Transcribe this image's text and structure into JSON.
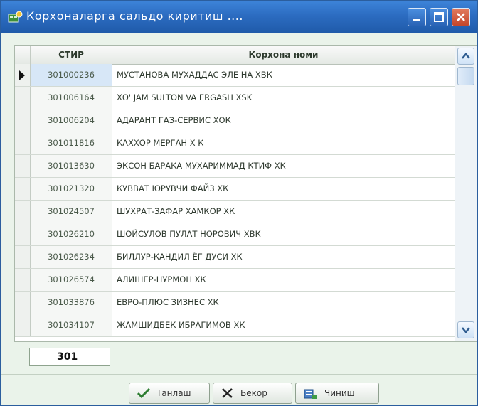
{
  "window": {
    "title": "Корхоналарга сальдо киритиш ...."
  },
  "grid": {
    "columns": [
      "СТИР",
      "Корхона номи"
    ],
    "rows": [
      {
        "code": "301000236",
        "name": "МУСТАНОВА МУХАДДАС ЭЛЕ НА ХВК"
      },
      {
        "code": "301006164",
        "name": "ХО' JAM SULTON VA ERGASH XSK"
      },
      {
        "code": "301006204",
        "name": "АДАРАНТ ГАЗ-СЕРВИС ХОК"
      },
      {
        "code": "301011816",
        "name": "КАХХОР МЕРГАН Х К"
      },
      {
        "code": "301013630",
        "name": "ЭКСОН БАРАКА МУХАРИММАД КТИФ ХК"
      },
      {
        "code": "301021320",
        "name": "КУВВАТ ЮРУВЧИ ФАЙЗ ХК"
      },
      {
        "code": "301024507",
        "name": "ШУХРАТ-ЗАФАР ХАМКОР ХК"
      },
      {
        "code": "301026210",
        "name": "ШОЙСУЛОВ ПУЛАТ НОРОВИЧ ХВК"
      },
      {
        "code": "301026234",
        "name": "БИЛЛУР-КАНДИЛ ЁГ ДУСИ ХК"
      },
      {
        "code": "301026574",
        "name": "АЛИШЕР-НУРМОН ХК"
      },
      {
        "code": "301033876",
        "name": "ЕВРО-ПЛЮС ЗИЗНЕС ХК"
      },
      {
        "code": "301034107",
        "name": "ЖАМШИДБЕК ИБРАГИМОВ ХК"
      }
    ]
  },
  "search": {
    "value": "301"
  },
  "buttons": {
    "ok": "Танлаш",
    "cancel": "Бекор",
    "clear": "Чиниш"
  },
  "colors": {
    "titlebar": "#2c6cc1",
    "background": "#eaf3ea",
    "close_button": "#c3462b"
  }
}
